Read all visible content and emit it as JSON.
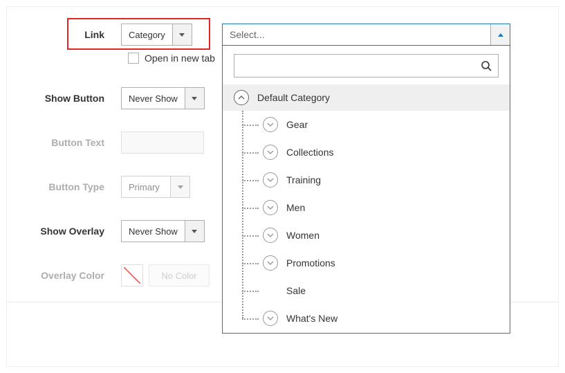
{
  "fields": {
    "link": {
      "label": "Link",
      "value": "Category"
    },
    "open_new_tab": {
      "label": "Open in new tab",
      "checked": false
    },
    "show_button": {
      "label": "Show Button",
      "value": "Never Show"
    },
    "button_text": {
      "label": "Button Text",
      "value": ""
    },
    "button_type": {
      "label": "Button Type",
      "value": "Primary"
    },
    "show_overlay": {
      "label": "Show Overlay",
      "value": "Never Show"
    },
    "overlay_color": {
      "label": "Overlay Color",
      "value": "No Color"
    }
  },
  "category_select": {
    "placeholder": "Select...",
    "search_value": ""
  },
  "category_tree": {
    "root": "Default Category",
    "children": [
      {
        "label": "Gear",
        "expandable": true
      },
      {
        "label": "Collections",
        "expandable": true
      },
      {
        "label": "Training",
        "expandable": true
      },
      {
        "label": "Men",
        "expandable": true
      },
      {
        "label": "Women",
        "expandable": true
      },
      {
        "label": "Promotions",
        "expandable": true
      },
      {
        "label": "Sale",
        "expandable": false
      },
      {
        "label": "What's New",
        "expandable": true
      }
    ]
  }
}
